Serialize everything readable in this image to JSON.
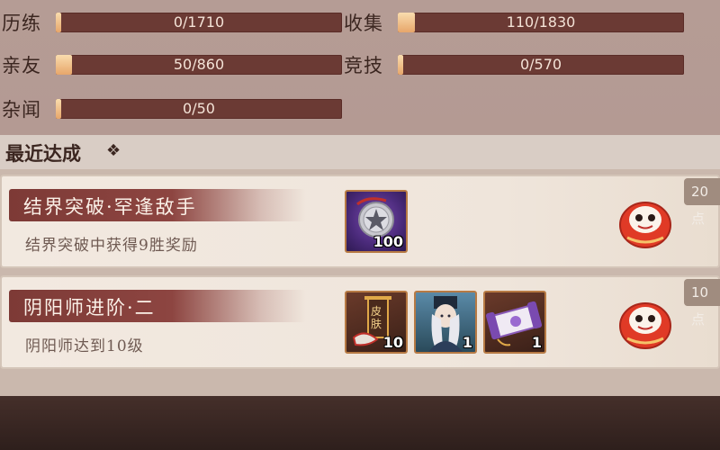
{
  "stats": [
    {
      "label": "历练",
      "value": "0/1710",
      "fill": 0.0
    },
    {
      "label": "收集",
      "value": "110/1830",
      "fill": 0.06
    },
    {
      "label": "亲友",
      "value": "50/860",
      "fill": 0.058
    },
    {
      "label": "竞技",
      "value": "0/570",
      "fill": 0.0
    },
    {
      "label": "杂闻",
      "value": "0/50",
      "fill": 0.0
    }
  ],
  "recent": {
    "title": "最近达成",
    "diamond": "❖"
  },
  "cards": [
    {
      "title": "结界突破·罕逢敌手",
      "desc": "结界突破中获得9胜奖励",
      "points": "20点",
      "rewards": [
        {
          "icon": "pentagram-coin-icon",
          "count": "100"
        }
      ]
    },
    {
      "title": "阴阳师进阶·二",
      "desc": "阴阳师达到10级",
      "points": "10点",
      "rewards": [
        {
          "icon": "skin-banner-icon",
          "count": "10",
          "badge": "皮肤"
        },
        {
          "icon": "onmyoji-portrait-icon",
          "count": "1"
        },
        {
          "icon": "purple-scroll-icon",
          "count": "1"
        }
      ]
    }
  ],
  "colors": {
    "panel": "#b59c95",
    "bar": "#6b3a34",
    "bar_fill": "#e7a66a",
    "ribbon": "#7d3a36",
    "card": "#f2e9e0"
  }
}
